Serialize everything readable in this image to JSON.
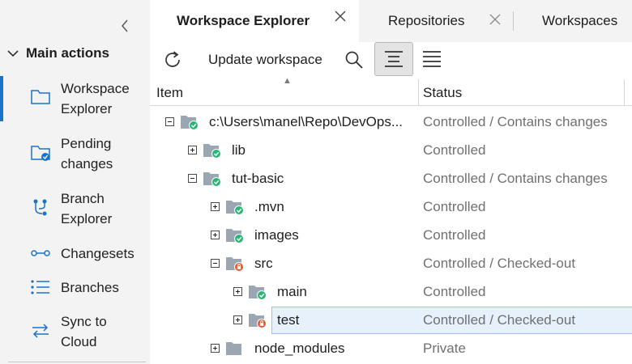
{
  "sidebar": {
    "section_title": "Main actions",
    "items": [
      {
        "label_line1": "Workspace",
        "label_line2": "Explorer",
        "icon": "folder-icon",
        "active": true
      },
      {
        "label_line1": "Pending",
        "label_line2": "changes",
        "icon": "pending-changes-icon"
      },
      {
        "label_line1": "Branch",
        "label_line2": "Explorer",
        "icon": "branch-explorer-icon"
      },
      {
        "label_line1": "Changesets",
        "label_line2": "",
        "icon": "changesets-icon"
      },
      {
        "label_line1": "Branches",
        "label_line2": "",
        "icon": "branches-icon"
      },
      {
        "label_line1": "Sync to",
        "label_line2": "Cloud",
        "icon": "sync-icon"
      }
    ]
  },
  "tabs": [
    {
      "label": "Workspace Explorer",
      "active": true
    },
    {
      "label": "Repositories"
    },
    {
      "label": "Workspaces"
    }
  ],
  "toolbar": {
    "update_label": "Update workspace"
  },
  "columns": {
    "item": "Item",
    "status": "Status"
  },
  "rows": [
    {
      "name": "c:\\Users\\manel\\Repo\\DevOps...",
      "status": "Controlled / Contains changes",
      "state": "expanded",
      "badge": "check"
    },
    {
      "name": "lib",
      "status": "Controlled",
      "state": "collapsed",
      "badge": "check"
    },
    {
      "name": "tut-basic",
      "status": "Controlled / Contains changes",
      "state": "expanded",
      "badge": "check"
    },
    {
      "name": ".mvn",
      "status": "Controlled",
      "state": "collapsed",
      "badge": "check"
    },
    {
      "name": "images",
      "status": "Controlled",
      "state": "collapsed",
      "badge": "check"
    },
    {
      "name": "src",
      "status": "Controlled / Checked-out",
      "state": "expanded",
      "badge": "checkout"
    },
    {
      "name": "main",
      "status": "Controlled",
      "state": "collapsed",
      "badge": "check"
    },
    {
      "name": "test",
      "status": "Controlled / Checked-out",
      "state": "collapsed",
      "badge": "checkout",
      "selected": true
    },
    {
      "name": "node_modules",
      "status": "Private",
      "state": "collapsed",
      "badge": "none"
    }
  ],
  "colors": {
    "accent": "#1a73c9",
    "controlled": "#2bb673",
    "checkout": "#e8562a",
    "folder": "#9aa7b3"
  }
}
